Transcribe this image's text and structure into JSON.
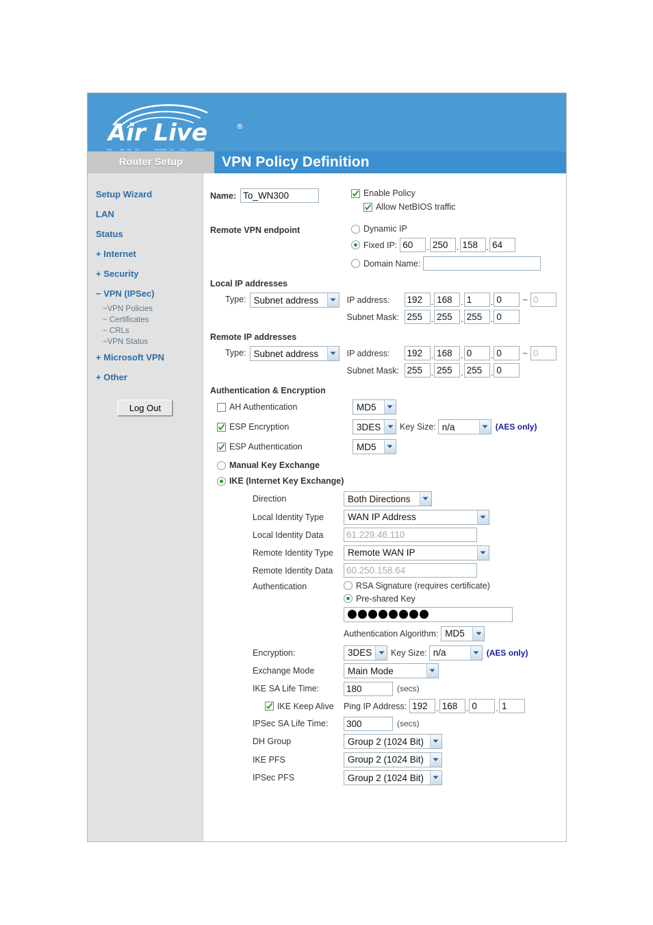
{
  "brand": {
    "name": "Air Live",
    "trademark": "®"
  },
  "header": {
    "nav_title": "Router Setup",
    "page_title": "VPN Policy Definition"
  },
  "sidebar": {
    "items": [
      {
        "label": "Setup Wizard",
        "type": "top"
      },
      {
        "label": "LAN",
        "type": "top"
      },
      {
        "label": "Status",
        "type": "top"
      },
      {
        "label": "+ Internet",
        "type": "top"
      },
      {
        "label": "+ Security",
        "type": "top"
      },
      {
        "label": "− VPN (IPSec)",
        "type": "top"
      },
      {
        "label": "−VPN Policies",
        "type": "sub"
      },
      {
        "label": "− Certificates",
        "type": "sub"
      },
      {
        "label": "− CRLs",
        "type": "sub"
      },
      {
        "label": "−VPN Status",
        "type": "sub"
      },
      {
        "label": "+ Microsoft VPN",
        "type": "top"
      },
      {
        "label": "+ Other",
        "type": "top"
      }
    ],
    "logout_label": "Log Out"
  },
  "form": {
    "name_label": "Name:",
    "name_value": "To_WN300",
    "enable_policy_label": "Enable Policy",
    "enable_policy_checked": true,
    "netbios_label": "Allow NetBIOS traffic",
    "netbios_checked": true,
    "remote_endpoint_heading": "Remote VPN endpoint",
    "dynamic_ip_label": "Dynamic IP",
    "dynamic_ip_selected": false,
    "fixed_ip_label": "Fixed IP:",
    "fixed_ip_selected": true,
    "fixed_ip_octets": [
      "60",
      "250",
      "158",
      "64"
    ],
    "domain_name_label": "Domain Name:",
    "domain_name_selected": false,
    "domain_name_value": "",
    "local_ip_heading": "Local IP addresses",
    "local_type_label": "Type:",
    "local_type_value": "Subnet address",
    "local_ip_label": "IP address:",
    "local_ip_octets": [
      "192",
      "168",
      "1",
      "0"
    ],
    "local_ip_range_end": "0",
    "local_mask_label": "Subnet Mask:",
    "local_mask_octets": [
      "255",
      "255",
      "255",
      "0"
    ],
    "remote_ip_heading": "Remote IP addresses",
    "remote_type_label": "Type:",
    "remote_type_value": "Subnet address",
    "remote_ip_label": "IP address:",
    "remote_ip_octets": [
      "192",
      "168",
      "0",
      "0"
    ],
    "remote_ip_range_end": "0",
    "remote_mask_label": "Subnet Mask:",
    "remote_mask_octets": [
      "255",
      "255",
      "255",
      "0"
    ],
    "auth_enc_heading": "Authentication & Encryption",
    "ah_auth_label": "AH Authentication",
    "ah_auth_checked": false,
    "ah_auth_algo": "MD5",
    "esp_enc_label": "ESP Encryption",
    "esp_enc_checked": true,
    "esp_enc_algo": "3DES",
    "esp_keysize_label": "Key Size:",
    "esp_keysize_value": "n/a",
    "aes_only_note": "(AES only)",
    "esp_auth_label": "ESP Authentication",
    "esp_auth_checked": true,
    "esp_auth_algo": "MD5",
    "manual_key_label": "Manual Key Exchange",
    "manual_key_selected": false,
    "ike_label": "IKE (Internet Key Exchange)",
    "ike_selected": true,
    "direction_label": "Direction",
    "direction_value": "Both Directions",
    "local_id_type_label": "Local Identity Type",
    "local_id_type_value": "WAN IP Address",
    "local_id_data_label": "Local Identity Data",
    "local_id_data_value": "61.229.46.110",
    "remote_id_type_label": "Remote Identity Type",
    "remote_id_type_value": "Remote WAN IP",
    "remote_id_data_label": "Remote Identity Data",
    "remote_id_data_value": "60.250.158.64",
    "authentication_label": "Authentication",
    "rsa_label": "RSA Signature (requires certificate)",
    "rsa_selected": false,
    "psk_label": "Pre-shared Key",
    "psk_selected": true,
    "psk_dots": 8,
    "auth_algo_label": "Authentication Algorithm:",
    "auth_algo_value": "MD5",
    "encryption_label": "Encryption:",
    "encryption_value": "3DES",
    "ike_keysize_label": "Key Size:",
    "ike_keysize_value": "n/a",
    "ike_aes_only_note": "(AES only)",
    "exchange_mode_label": "Exchange Mode",
    "exchange_mode_value": "Main Mode",
    "ike_sa_label": "IKE SA Life Time:",
    "ike_sa_value": "180",
    "secs_note": "(secs)",
    "keepalive_label": "IKE Keep Alive",
    "keepalive_checked": true,
    "ping_ip_label": "Ping IP Address:",
    "ping_ip_octets": [
      "192",
      "168",
      "0",
      "1"
    ],
    "ipsec_sa_label": "IPSec SA Life Time:",
    "ipsec_sa_value": "300",
    "ipsec_secs_note": "(secs)",
    "dh_group_label": "DH Group",
    "dh_group_value": "Group 2 (1024 Bit)",
    "ike_pfs_label": "IKE PFS",
    "ike_pfs_value": "Group 2 (1024 Bit)",
    "ipsec_pfs_label": "IPSec PFS",
    "ipsec_pfs_value": "Group 2 (1024 Bit)"
  },
  "colors": {
    "banner_blue": "#4a9ad4",
    "title_blue": "#3b8fd0",
    "nav_gray": "#c8c8c8",
    "sidebar_gray": "#e2e2e2",
    "link_blue": "#2e6da4",
    "note_navy": "#1a1aa0",
    "check_green": "#2e9b2e"
  }
}
